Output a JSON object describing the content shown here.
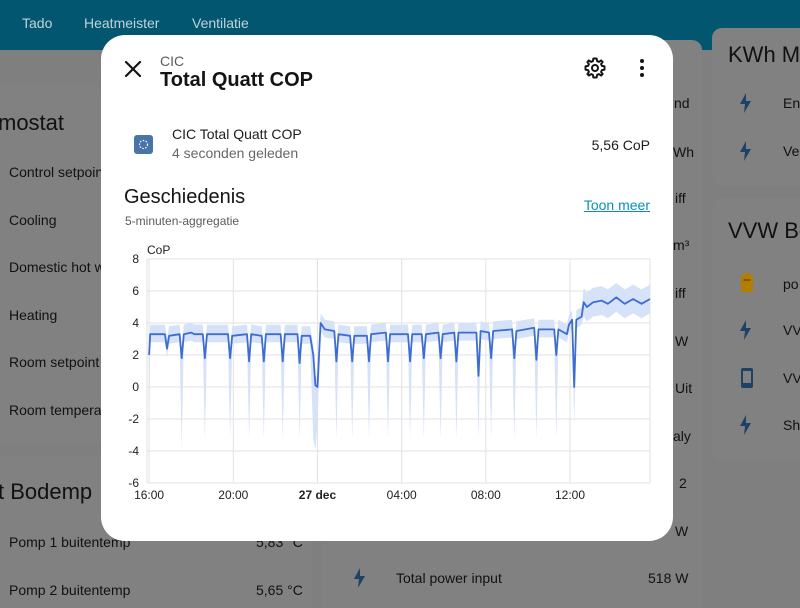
{
  "topbar": {
    "tabs": [
      "Tado",
      "Heatmeister",
      "Ventilatie"
    ]
  },
  "background": {
    "thermostat_title": "mostat",
    "thermostat_rows": [
      "Control setpoin",
      "Cooling",
      "Domestic hot w",
      "Heating",
      "Room setpoint",
      "Room tempera"
    ],
    "bodem_title": "t Bodemp",
    "bodem_rows": [
      {
        "label": "Pomp 1 buitentemp",
        "value": "5,83 °C"
      },
      {
        "label": "Pomp 2 buitentemp",
        "value": "5,65 °C"
      }
    ],
    "middle_values": [
      "nd",
      "Wh",
      "iff",
      "m³",
      "iff",
      "W",
      "Uit",
      "aly",
      "2",
      "W"
    ],
    "total_power": {
      "label": "Total power input",
      "value": "518 W"
    },
    "kwh_title": "KWh M",
    "kwh_rows": [
      "Ene",
      "Ve"
    ],
    "vvw_title": "VVW Bo",
    "vvw_rows": [
      "po",
      "VV",
      "VV",
      "Sh"
    ],
    "colors": {
      "bolt": "#1d4266",
      "battery": "#b37e00"
    }
  },
  "dialog": {
    "subtitle": "CIC",
    "title": "Total Quatt COP",
    "entity": {
      "name": "CIC Total Quatt COP",
      "time": "4 seconden geleden",
      "state": "5,56 CoP"
    },
    "history": {
      "title": "Geschiedenis",
      "aggregation": "5-minuten-aggregatie",
      "more_link": "Toon meer"
    }
  },
  "chart_data": {
    "type": "line",
    "ylabel": "CoP",
    "ylim": [
      -6,
      8
    ],
    "y_ticks": [
      "8",
      "6",
      "4",
      "2",
      "0",
      "-2",
      "-4",
      "-6"
    ],
    "x_ticks": [
      {
        "label": "16:00",
        "hour": 0
      },
      {
        "label": "20:00",
        "hour": 4
      },
      {
        "label": "27 dec",
        "hour": 8,
        "bold": true
      },
      {
        "label": "04:00",
        "hour": 12
      },
      {
        "label": "08:00",
        "hour": 16
      },
      {
        "label": "12:00",
        "hour": 20
      }
    ],
    "x_range_hours": [
      -0.1,
      23.8
    ],
    "colors": {
      "line": "#3e6dd1",
      "band": "#d6e2f8"
    },
    "series": [
      {
        "values_by_hour": [
          [
            0.0,
            2.0
          ],
          [
            0.05,
            3.3
          ],
          [
            0.75,
            3.3
          ],
          [
            0.85,
            2.4
          ],
          [
            0.95,
            3.2
          ],
          [
            1.45,
            3.3
          ],
          [
            1.55,
            1.8
          ],
          [
            1.65,
            3.3
          ],
          [
            2.0,
            3.4
          ],
          [
            2.15,
            3.3
          ],
          [
            2.55,
            3.3
          ],
          [
            2.65,
            1.8
          ],
          [
            2.75,
            3.3
          ],
          [
            3.75,
            3.3
          ],
          [
            3.85,
            1.8
          ],
          [
            3.95,
            3.2
          ],
          [
            4.65,
            3.3
          ],
          [
            4.75,
            1.6
          ],
          [
            4.85,
            3.3
          ],
          [
            5.35,
            3.2
          ],
          [
            5.45,
            1.6
          ],
          [
            5.55,
            3.3
          ],
          [
            6.25,
            3.3
          ],
          [
            6.35,
            1.6
          ],
          [
            6.45,
            3.3
          ],
          [
            7.05,
            3.3
          ],
          [
            7.15,
            1.5
          ],
          [
            7.25,
            3.2
          ],
          [
            7.65,
            3.2
          ],
          [
            7.8,
            2.0
          ],
          [
            7.9,
            0.1
          ],
          [
            8.0,
            0.0
          ],
          [
            8.15,
            4.0
          ],
          [
            8.35,
            3.6
          ],
          [
            8.8,
            3.5
          ],
          [
            8.9,
            1.6
          ],
          [
            9.0,
            3.3
          ],
          [
            9.55,
            3.2
          ],
          [
            9.65,
            1.6
          ],
          [
            9.75,
            3.2
          ],
          [
            10.35,
            3.2
          ],
          [
            10.45,
            1.6
          ],
          [
            10.55,
            3.3
          ],
          [
            11.25,
            3.4
          ],
          [
            11.35,
            1.6
          ],
          [
            11.45,
            3.3
          ],
          [
            12.3,
            3.3
          ],
          [
            12.4,
            1.6
          ],
          [
            12.5,
            3.3
          ],
          [
            12.95,
            3.3
          ],
          [
            13.05,
            1.8
          ],
          [
            13.15,
            3.3
          ],
          [
            13.75,
            3.4
          ],
          [
            13.85,
            1.8
          ],
          [
            13.95,
            3.3
          ],
          [
            14.5,
            3.4
          ],
          [
            14.6,
            1.6
          ],
          [
            14.7,
            3.4
          ],
          [
            15.55,
            3.4
          ],
          [
            15.65,
            0.7
          ],
          [
            15.75,
            3.5
          ],
          [
            16.15,
            3.4
          ],
          [
            16.25,
            1.8
          ],
          [
            16.35,
            3.5
          ],
          [
            17.25,
            3.6
          ],
          [
            17.35,
            1.8
          ],
          [
            17.45,
            3.5
          ],
          [
            18.3,
            3.7
          ],
          [
            18.4,
            1.7
          ],
          [
            18.5,
            3.6
          ],
          [
            19.25,
            3.6
          ],
          [
            19.35,
            2.0
          ],
          [
            19.45,
            3.6
          ],
          [
            19.85,
            3.3
          ],
          [
            19.95,
            3.9
          ],
          [
            20.1,
            4.2
          ],
          [
            20.2,
            0.0
          ],
          [
            20.3,
            4.2
          ],
          [
            20.55,
            4.4
          ],
          [
            20.65,
            5.3
          ],
          [
            20.8,
            5.0
          ],
          [
            21.1,
            5.3
          ],
          [
            21.5,
            5.4
          ],
          [
            21.8,
            5.2
          ],
          [
            22.2,
            5.6
          ],
          [
            22.6,
            5.2
          ],
          [
            23.0,
            5.5
          ],
          [
            23.4,
            5.2
          ],
          [
            23.8,
            5.5
          ]
        ]
      }
    ]
  }
}
